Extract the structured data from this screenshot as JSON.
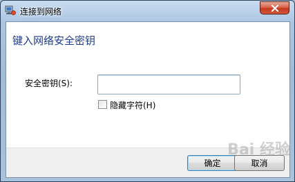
{
  "window": {
    "title": "连接到网络",
    "icon": "network-connect-icon",
    "close_icon": "close-icon"
  },
  "dialog": {
    "heading": "键入网络安全密钥",
    "field_label": "安全密钥(S):",
    "field_value": "",
    "checkbox_label": "隐藏字符(H)",
    "checkbox_checked": false
  },
  "buttons": {
    "ok_label": "确定",
    "cancel_label": "取消"
  },
  "watermark": "Bai 经验",
  "colors": {
    "heading": "#1e3b8a",
    "close_button": "#c6381c",
    "default_button_border": "#3c7fb1"
  }
}
